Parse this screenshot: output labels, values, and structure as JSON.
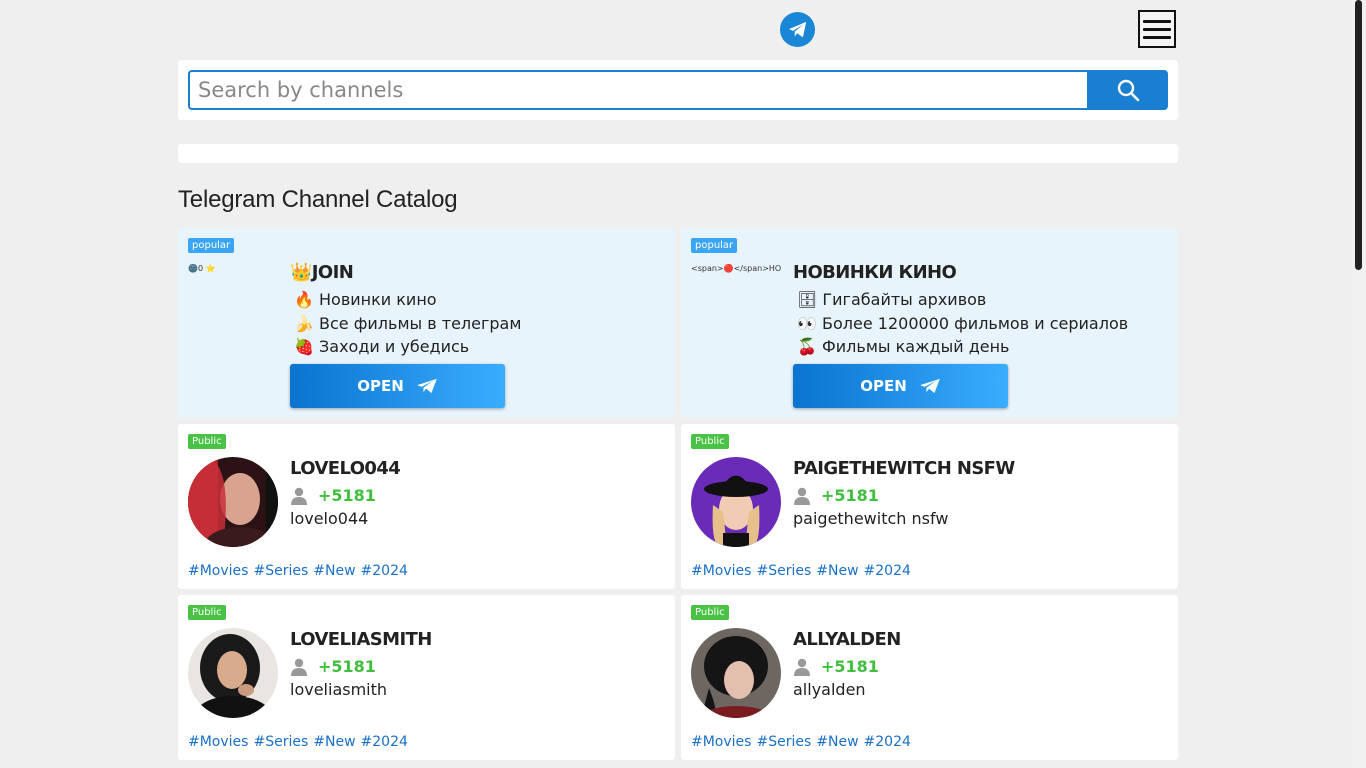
{
  "header": {
    "logo_icon": "telegram-icon",
    "menu_icon": "hamburger-icon"
  },
  "search": {
    "placeholder": "Search by channels",
    "button_icon": "search-icon",
    "accent": "#1a7fd0"
  },
  "page": {
    "title": "Telegram Channel Catalog"
  },
  "popular_cards": [
    {
      "badge": "popular",
      "image_alt": "🌚0 ⭐",
      "title": "👑JOIN",
      "lines": [
        "🔥 Новинки кино",
        "🍌 Все фильмы в телеграм",
        "🍓 Заходи и убедись"
      ],
      "button": "OPEN"
    },
    {
      "badge": "popular",
      "image_alt": "<span>🔴</span>НОВИНКИ КИНО",
      "title": "НОВИНКИ КИНО",
      "lines": [
        "🗄 Гигабайты архивов",
        "👀 Более 1200000 фильмов и сериалов",
        "🍒 Фильмы каждый день"
      ],
      "button": "OPEN"
    }
  ],
  "public_cards": [
    {
      "badge": "Public",
      "title": "LOVELO044",
      "count": "+5181",
      "handle": "lovelo044",
      "tags": [
        "#Movies",
        "#Series",
        "#New",
        "#2024"
      ]
    },
    {
      "badge": "Public",
      "title": "PAIGETHEWITCH NSFW",
      "count": "+5181",
      "handle": "paigethewitch nsfw",
      "tags": [
        "#Movies",
        "#Series",
        "#New",
        "#2024"
      ]
    },
    {
      "badge": "Public",
      "title": "LOVELIASMITH",
      "count": "+5181",
      "handle": "loveliasmith",
      "tags": [
        "#Movies",
        "#Series",
        "#New",
        "#2024"
      ]
    },
    {
      "badge": "Public",
      "title": "ALLYALDEN",
      "count": "+5181",
      "handle": "allyalden",
      "tags": [
        "#Movies",
        "#Series",
        "#New",
        "#2024"
      ]
    }
  ],
  "colors": {
    "popular_badge": "#3aa5f3",
    "public_badge": "#49c246",
    "count": "#3fbf3c",
    "tag": "#1a70c8"
  }
}
